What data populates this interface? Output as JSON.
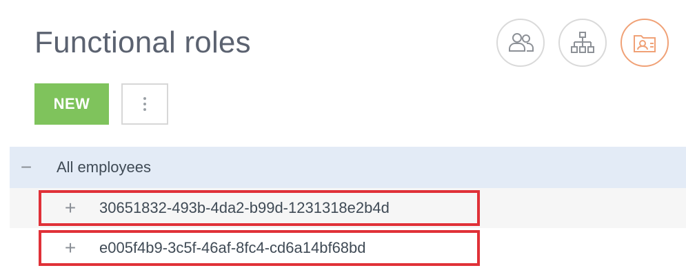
{
  "page": {
    "title": "Functional roles"
  },
  "mode_switcher": {
    "items": [
      {
        "icon": "users-icon",
        "active": false
      },
      {
        "icon": "org-structure-icon",
        "active": false
      },
      {
        "icon": "functional-roles-icon",
        "active": true
      }
    ],
    "active_color": "#f0a176"
  },
  "toolbar": {
    "new_label": "NEW",
    "more_label": "⋮"
  },
  "tree": {
    "root": {
      "toggle": "−",
      "label": "All employees"
    },
    "children": [
      {
        "toggle": "+",
        "label": "30651832-493b-4da2-b99d-1231318e2b4d",
        "highlighted": true
      },
      {
        "toggle": "+",
        "label": "e005f4b9-3c5f-46af-8fc4-cd6a14bf68bd",
        "highlighted": true
      }
    ],
    "highlight_color": "#e03138"
  },
  "colors": {
    "accent_green": "#7fc35c",
    "selected_row": "#e3ebf6"
  }
}
